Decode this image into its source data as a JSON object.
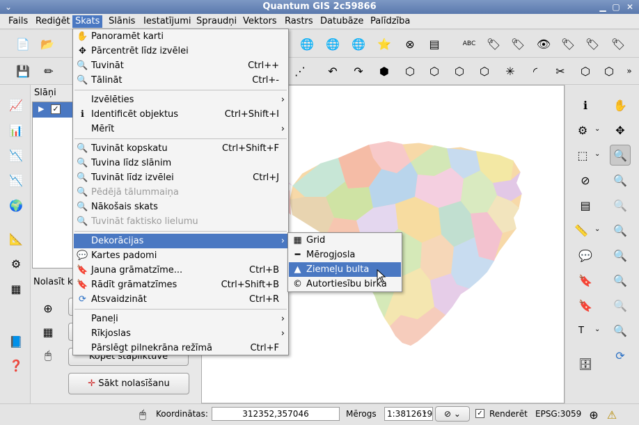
{
  "window": {
    "title": "Quantum GIS 2c59866"
  },
  "menubar": [
    "Fails",
    "Rediģēt",
    "Skats",
    "Slānis",
    "Iestatījumi",
    "Spraudņi",
    "Vektors",
    "Rastrs",
    "Datubāze",
    "Palīdzība"
  ],
  "view_menu": [
    {
      "label": "Panoramēt karti",
      "shortcut": "",
      "icon": "✋"
    },
    {
      "label": "Pārcentrēt līdz izvēlei",
      "shortcut": "",
      "icon": "✥"
    },
    {
      "label": "Tuvināt",
      "shortcut": "Ctrl++",
      "icon": "🔍"
    },
    {
      "label": "Tālināt",
      "shortcut": "Ctrl+-",
      "icon": "🔍"
    },
    {
      "label": "Izvēlēties",
      "shortcut": "",
      "icon": ""
    },
    {
      "label": "Identificēt objektus",
      "shortcut": "Ctrl+Shift+I",
      "icon": "ℹ"
    },
    {
      "label": "Mērīt",
      "shortcut": "",
      "icon": ""
    },
    {
      "label": "Tuvināt kopskatu",
      "shortcut": "Ctrl+Shift+F",
      "icon": "🔍"
    },
    {
      "label": "Tuvina līdz slānim",
      "shortcut": "",
      "icon": "🔍"
    },
    {
      "label": "Tuvināt līdz izvēlei",
      "shortcut": "Ctrl+J",
      "icon": "🔍"
    },
    {
      "label": "Pēdējā tālummaiņa",
      "shortcut": "",
      "icon": "🔍"
    },
    {
      "label": "Nākošais skats",
      "shortcut": "",
      "icon": "🔍"
    },
    {
      "label": "Tuvināt faktisko lielumu",
      "shortcut": "",
      "icon": "🔍"
    },
    {
      "label": "Dekorācijas",
      "shortcut": "",
      "icon": ""
    },
    {
      "label": "Kartes padomi",
      "shortcut": "",
      "icon": "💬"
    },
    {
      "label": "Jauna grāmatzīme...",
      "shortcut": "Ctrl+B",
      "icon": "🔖"
    },
    {
      "label": "Rādīt grāmatzīmes",
      "shortcut": "Ctrl+Shift+B",
      "icon": "🔖"
    },
    {
      "label": "Atsvaidzināt",
      "shortcut": "Ctrl+R",
      "icon": "⟳"
    },
    {
      "label": "Paneļi",
      "shortcut": "",
      "icon": ""
    },
    {
      "label": "Rīkjoslas",
      "shortcut": "",
      "icon": ""
    },
    {
      "label": "Pārslēgt pilnekrāna režīmā",
      "shortcut": "Ctrl+F",
      "icon": ""
    }
  ],
  "submenu": [
    {
      "label": "Grid",
      "icon": "▦"
    },
    {
      "label": "Mērogjosla",
      "icon": "━"
    },
    {
      "label": "Ziemeļu bulta",
      "icon": "▲"
    },
    {
      "label": "Autortiesību birka",
      "icon": "©"
    }
  ],
  "dock": {
    "layers_title": "Slāņi",
    "gps_title": "Nolasīt k",
    "copy_button": "Kopēt stapliktuve",
    "start_button": "Sākt nolasīšanu"
  },
  "status": {
    "coord_label": "Koordinātas:",
    "coord_value": "312352,357046",
    "scale_label": "Mērogs",
    "scale_value": "1:3812619",
    "render_label": "Renderēt",
    "epsg": "EPSG:3059"
  },
  "colors": {
    "title": "#6a87b9",
    "highlight": "#4a78c2"
  }
}
